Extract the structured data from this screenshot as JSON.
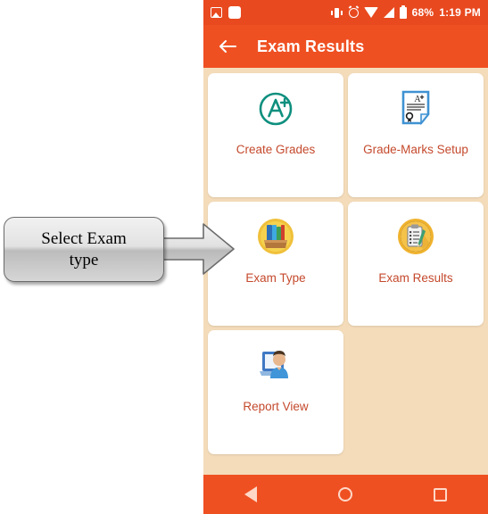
{
  "statusbar": {
    "icons_left": [
      "photo-icon",
      "white-square-icon"
    ],
    "icons_right": [
      "vibrate-icon",
      "alarm-icon",
      "wifi-icon",
      "signal-icon",
      "battery-icon"
    ],
    "battery": "68%",
    "time": "1:19 PM",
    "bg_color": "#e8491f"
  },
  "appbar": {
    "back_icon": "back-arrow-icon",
    "title": "Exam Results",
    "bg_color": "#ef5022",
    "text_color": "#ffffff"
  },
  "grid": {
    "bg_color": "#f4dcba",
    "tile_bg": "#ffffff",
    "label_color": "#c4492c",
    "tiles": [
      {
        "label": "Create Grades",
        "icon": "a-plus-circle-icon"
      },
      {
        "label": "Grade-Marks Setup",
        "icon": "certificate-document-icon"
      },
      {
        "label": "Exam Type",
        "icon": "books-box-icon"
      },
      {
        "label": "Exam Results",
        "icon": "clipboard-checklist-icon"
      },
      {
        "label": "Report View",
        "icon": "person-laptop-icon"
      }
    ]
  },
  "navbar": {
    "bg_color": "#ef5022",
    "buttons": [
      {
        "name": "nav-back-button",
        "icon": "triangle-back-icon"
      },
      {
        "name": "nav-home-button",
        "icon": "circle-home-icon"
      },
      {
        "name": "nav-recents-button",
        "icon": "square-recents-icon"
      }
    ]
  },
  "annotation": {
    "text_line1": "Select Exam",
    "text_line2": "type",
    "arrow_icon": "right-arrow-icon",
    "box_color": "#d6d6d6"
  }
}
